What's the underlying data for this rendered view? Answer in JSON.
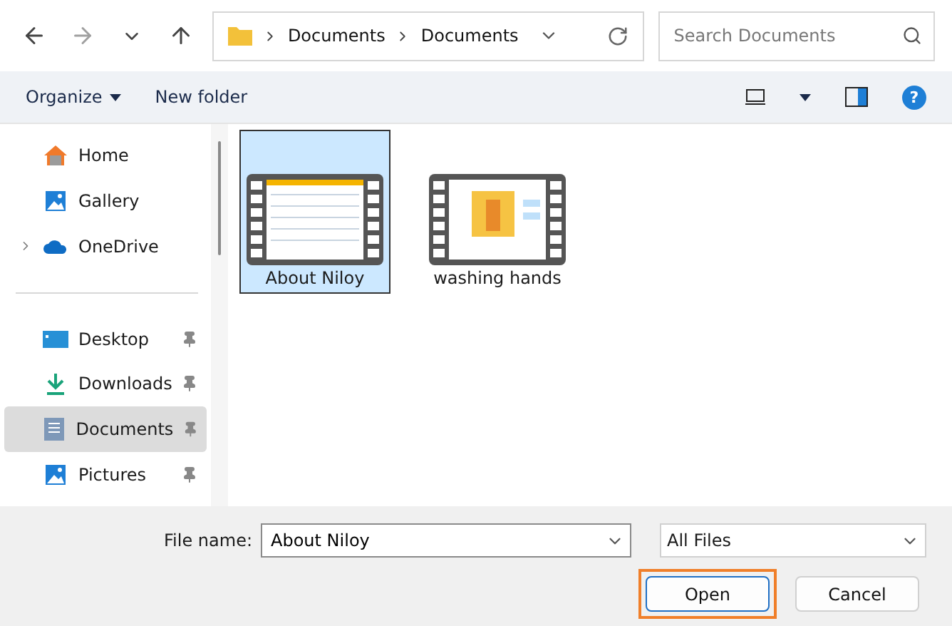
{
  "address_bar": {
    "breadcrumbs": [
      "Documents",
      "Documents"
    ]
  },
  "search": {
    "placeholder": "Search Documents"
  },
  "toolbar": {
    "organize": "Organize",
    "new_folder": "New folder",
    "help": "?"
  },
  "sidebar": {
    "groups": [
      {
        "items": [
          {
            "label": "Home",
            "selected": false,
            "pinned": false,
            "expandable": false
          },
          {
            "label": "Gallery",
            "selected": false,
            "pinned": false,
            "expandable": false
          },
          {
            "label": "OneDrive",
            "selected": false,
            "pinned": false,
            "expandable": true
          }
        ]
      },
      {
        "items": [
          {
            "label": "Desktop",
            "selected": false,
            "pinned": true,
            "expandable": false
          },
          {
            "label": "Downloads",
            "selected": false,
            "pinned": true,
            "expandable": false
          },
          {
            "label": "Documents",
            "selected": true,
            "pinned": true,
            "expandable": false
          },
          {
            "label": "Pictures",
            "selected": false,
            "pinned": true,
            "expandable": false
          }
        ]
      }
    ]
  },
  "files": [
    {
      "name": "About Niloy",
      "selected": true
    },
    {
      "name": "washing hands",
      "selected": false
    }
  ],
  "footer": {
    "file_name_label": "File name:",
    "file_name_value": "About Niloy",
    "file_type": "All Files",
    "buttons": [
      {
        "label": "Open",
        "highlighted": true
      },
      {
        "label": "Cancel",
        "highlighted": false
      }
    ]
  }
}
